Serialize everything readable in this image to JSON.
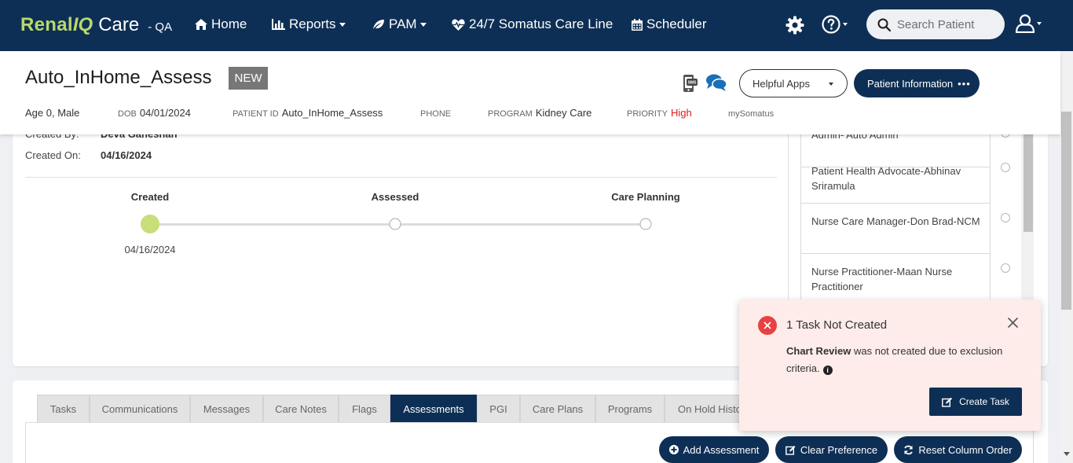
{
  "nav": {
    "brand_renal": "Renal",
    "brand_iq": "IQ",
    "brand_care": "Care",
    "env": "- QA",
    "home": "Home",
    "reports": "Reports",
    "pam": "PAM",
    "careline": "24/7 Somatus Care Line",
    "scheduler": "Scheduler",
    "search_placeholder": "Search Patient"
  },
  "patient": {
    "name": "Auto_InHome_Assess",
    "badge": "NEW",
    "helpful_apps": "Helpful Apps",
    "patient_info": "Patient Information",
    "patient_info_dots": "•••",
    "age_sex": "Age 0, Male",
    "dob_key": "DOB",
    "dob": "04/01/2024",
    "pid_key": "PATIENT ID",
    "pid": "Auto_InHome_Assess",
    "phone_key": "PHONE",
    "program_key": "PROGRAM",
    "program": "Kidney Care",
    "priority_key": "PRIORITY",
    "priority": "High",
    "mysomatus": "mySomatus"
  },
  "assessment": {
    "created_by_label": "Created By:",
    "created_by": "Deva Ganeshan",
    "created_on_label": "Created On:",
    "created_on": "04/16/2024",
    "steps": [
      {
        "label": "Created",
        "date": "04/16/2024",
        "done": true
      },
      {
        "label": "Assessed",
        "date": "",
        "done": false
      },
      {
        "label": "Care Planning",
        "date": "",
        "done": false
      }
    ],
    "accent_done": "#c9dd7a"
  },
  "assignees": [
    "Admin- Auto Admin",
    "Patient Health Advocate-Abhinav Sriramula",
    "Nurse Care Manager-Don Brad-NCM",
    "Nurse Practitioner-Maan Nurse Practitioner"
  ],
  "tabs": [
    "Tasks",
    "Communications",
    "Messages",
    "Care Notes",
    "Flags",
    "Assessments",
    "PGI",
    "Care Plans",
    "Programs",
    "On Hold History"
  ],
  "active_tab": "Assessments",
  "buttons": {
    "add_assessment": "Add Assessment",
    "clear_preference": "Clear Preference",
    "reset_column_order": "Reset Column Order"
  },
  "toast": {
    "title": "1 Task Not Created",
    "task_name": "Chart Review",
    "message": " was not created due to exclusion criteria.",
    "action": "Create Task"
  },
  "colors": {
    "primary": "#0e2f55",
    "brand_green": "#b8d86b",
    "priority_high": "#e0161b",
    "error": "#e84142"
  }
}
